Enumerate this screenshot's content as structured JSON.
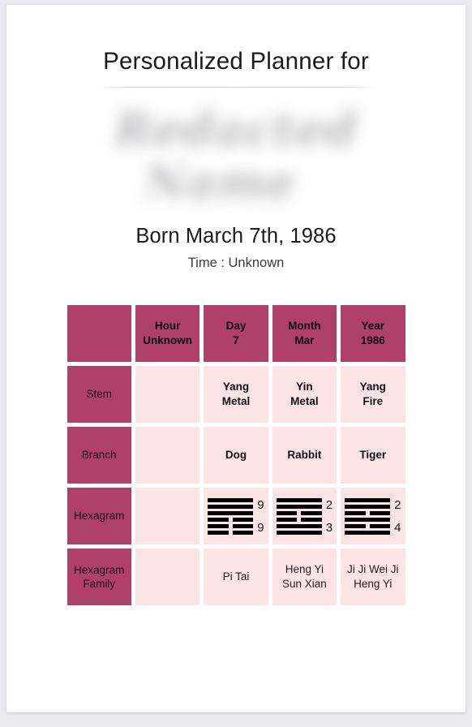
{
  "header": {
    "title": "Personalized Planner for",
    "client_name_redacted_line1": "Redacted",
    "client_name_redacted_line2": "Name",
    "born_line": "Born March 7th, 1986",
    "time_line": "Time :  Unknown"
  },
  "colors": {
    "accent_dark": "#AE4069",
    "cell_light": "#FCE4E6",
    "paper": "#FFFFFF",
    "backdrop": "#E9EAEE",
    "hexagram_line": "#000000"
  },
  "table": {
    "columns": [
      {
        "label_top": "",
        "label_bottom": ""
      },
      {
        "label_top": "Hour",
        "label_bottom": "Unknown"
      },
      {
        "label_top": "Day",
        "label_bottom": "7"
      },
      {
        "label_top": "Month",
        "label_bottom": "Mar"
      },
      {
        "label_top": "Year",
        "label_bottom": "1986"
      }
    ],
    "rows": {
      "stem": {
        "label": "Stem",
        "cells": [
          {
            "line1": "",
            "line2": ""
          },
          {
            "line1": "Yang",
            "line2": "Metal"
          },
          {
            "line1": "Yin",
            "line2": "Metal"
          },
          {
            "line1": "Yang",
            "line2": "Fire"
          }
        ]
      },
      "branch": {
        "label": "Branch",
        "cells": [
          {
            "line1": "",
            "line2": ""
          },
          {
            "line1": "Dog",
            "line2": ""
          },
          {
            "line1": "Rabbit",
            "line2": ""
          },
          {
            "line1": "Tiger",
            "line2": ""
          }
        ]
      },
      "hexagram": {
        "label": "Hexagram",
        "cells": [
          {
            "lines": [],
            "num_top": "",
            "num_bottom": ""
          },
          {
            "lines": [
              "yang",
              "yang",
              "yang",
              "yin",
              "yin",
              "yin"
            ],
            "num_top": "9",
            "num_bottom": "9"
          },
          {
            "lines": [
              "yang",
              "yang",
              "yin",
              "yin",
              "yang",
              "yang"
            ],
            "num_top": "2",
            "num_bottom": "3"
          },
          {
            "lines": [
              "yang",
              "yang",
              "yin",
              "yang",
              "yin",
              "yang"
            ],
            "num_top": "2",
            "num_bottom": "4"
          }
        ]
      },
      "hexagram_family": {
        "label_line1": "Hexagram",
        "label_line2": "Family",
        "cells": [
          {
            "line1": "",
            "line2": ""
          },
          {
            "line1": "Pi Tai",
            "line2": ""
          },
          {
            "line1": "Heng Yi",
            "line2": "Sun Xian"
          },
          {
            "line1": "Ji Ji Wei Ji",
            "line2": "Heng Yi"
          }
        ]
      }
    }
  }
}
